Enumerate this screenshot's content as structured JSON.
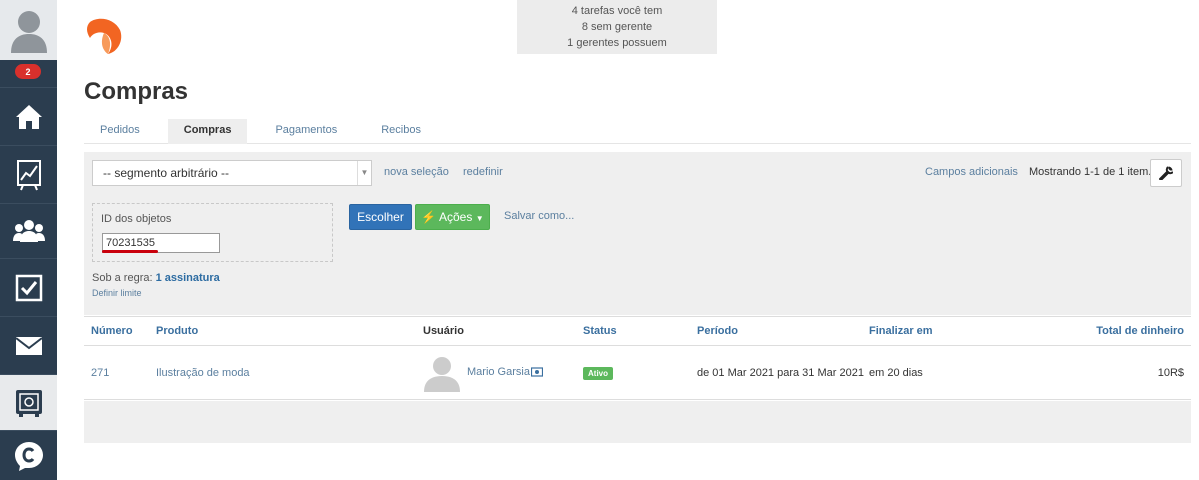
{
  "sidebar": {
    "badge_count": "2",
    "items": [
      {
        "icon": "home-icon"
      },
      {
        "icon": "chart-icon"
      },
      {
        "icon": "users-icon"
      },
      {
        "icon": "checkbox-icon"
      },
      {
        "icon": "mail-icon"
      },
      {
        "icon": "safe-icon"
      },
      {
        "icon": "chat-icon"
      }
    ]
  },
  "notifications": {
    "line1": "4 tarefas você tem",
    "line2": "8 sem gerente",
    "line3": "1 gerentes possuem"
  },
  "page": {
    "title": "Compras"
  },
  "tabs": [
    {
      "label": "Pedidos",
      "active": false
    },
    {
      "label": "Compras",
      "active": true
    },
    {
      "label": "Pagamentos",
      "active": false
    },
    {
      "label": "Recibos",
      "active": false
    }
  ],
  "filter": {
    "segment_value": "-- segmento arbitrário --",
    "nova_selecao": "nova seleção",
    "redefinir": "redefinir",
    "campos_adicionais": "Campos adicionais",
    "mostrando": "Mostrando 1-1 de 1 item.",
    "id_label": "ID dos objetos",
    "id_value": "70231535",
    "escolher": "Escolher",
    "acoes": "Ações",
    "salvar_como": "Salvar como...",
    "regra_prefix": "Sob a regra: ",
    "regra_link": "1 assinatura",
    "definir_limite": "Definir limite"
  },
  "table": {
    "headers": {
      "numero": "Número",
      "produto": "Produto",
      "usuario": "Usuário",
      "status": "Status",
      "periodo": "Período",
      "finalizar": "Finalizar em",
      "total": "Total de dinheiro"
    },
    "rows": [
      {
        "numero": "271",
        "produto": "Ilustração de moda",
        "usuario": "Mario Garsia",
        "status": "Ativo",
        "periodo": "de 01 Mar 2021 para 31 Mar 2021",
        "finalizar": "em 20 dias",
        "total": "10R$"
      }
    ]
  },
  "colors": {
    "sidebar_bg": "#2b3d4f",
    "accent_blue": "#3173b8",
    "accent_green": "#5cb85c",
    "link": "#5b7f9f",
    "badge_red": "#d9302c",
    "logo_orange": "#f26522"
  }
}
